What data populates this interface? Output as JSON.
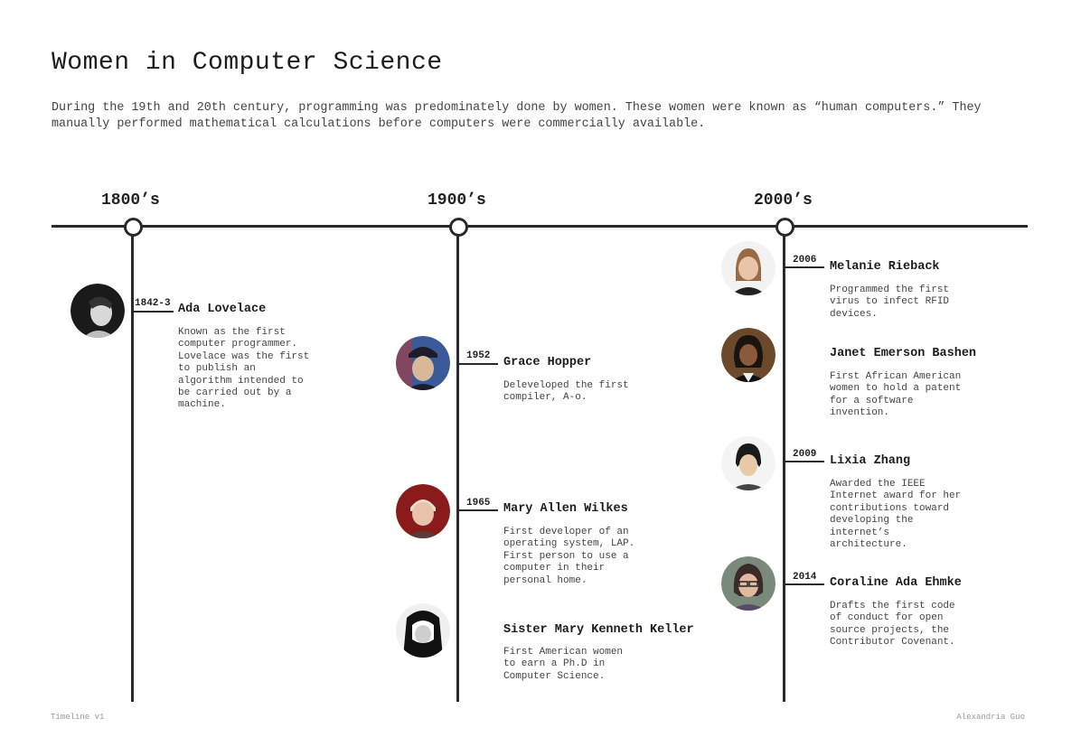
{
  "page": {
    "title": "Women in Computer Science",
    "intro": "During the 19th and 20th century, programming was predominately done by women. These women were known as “human computers.” They manually performed mathematical calculations before computers were commercially available."
  },
  "eras": [
    "1800’s",
    "1900’s",
    "2000’s"
  ],
  "people": [
    {
      "year": "1842-3",
      "name": "Ada Lovelace",
      "desc": "Known as the first computer programmer. Lovelace was the first to publish an algorithm intended to be carried out by a machine.",
      "portrait": "ada-lovelace-portrait"
    },
    {
      "year": "1952",
      "name": "Grace Hopper",
      "desc": "Deleveloped the first compiler, A-o.",
      "portrait": "grace-hopper-portrait"
    },
    {
      "year": "1965",
      "name": "Mary Allen Wilkes",
      "desc": "First developer of an operating system, LAP. First person to use a computer in their personal home.",
      "portrait": "mary-allen-wilkes-portrait"
    },
    {
      "year": "",
      "name": "Sister Mary Kenneth Keller",
      "desc": "First American women to earn a Ph.D in Computer Science.",
      "portrait": "mary-kenneth-keller-portrait"
    },
    {
      "year": "2006",
      "name": "Melanie Rieback",
      "desc": "Programmed the first virus to infect RFID devices.",
      "portrait": "melanie-rieback-portrait"
    },
    {
      "year": "",
      "name": "Janet Emerson Bashen",
      "desc": "First African American women to hold a patent for a software invention.",
      "portrait": "janet-emerson-bashen-portrait"
    },
    {
      "year": "2009",
      "name": "Lixia Zhang",
      "desc": "Awarded the IEEE Internet award for her contributions toward developing the internet’s architecture.",
      "portrait": "lixia-zhang-portrait"
    },
    {
      "year": "2014",
      "name": "Coraline Ada Ehmke",
      "desc": "Drafts the first code of conduct for open source projects, the Contributor Covenant.",
      "portrait": "coraline-ada-ehmke-portrait"
    }
  ],
  "footer": {
    "left": "Timeline v1",
    "right": "Alexandria Guo"
  }
}
